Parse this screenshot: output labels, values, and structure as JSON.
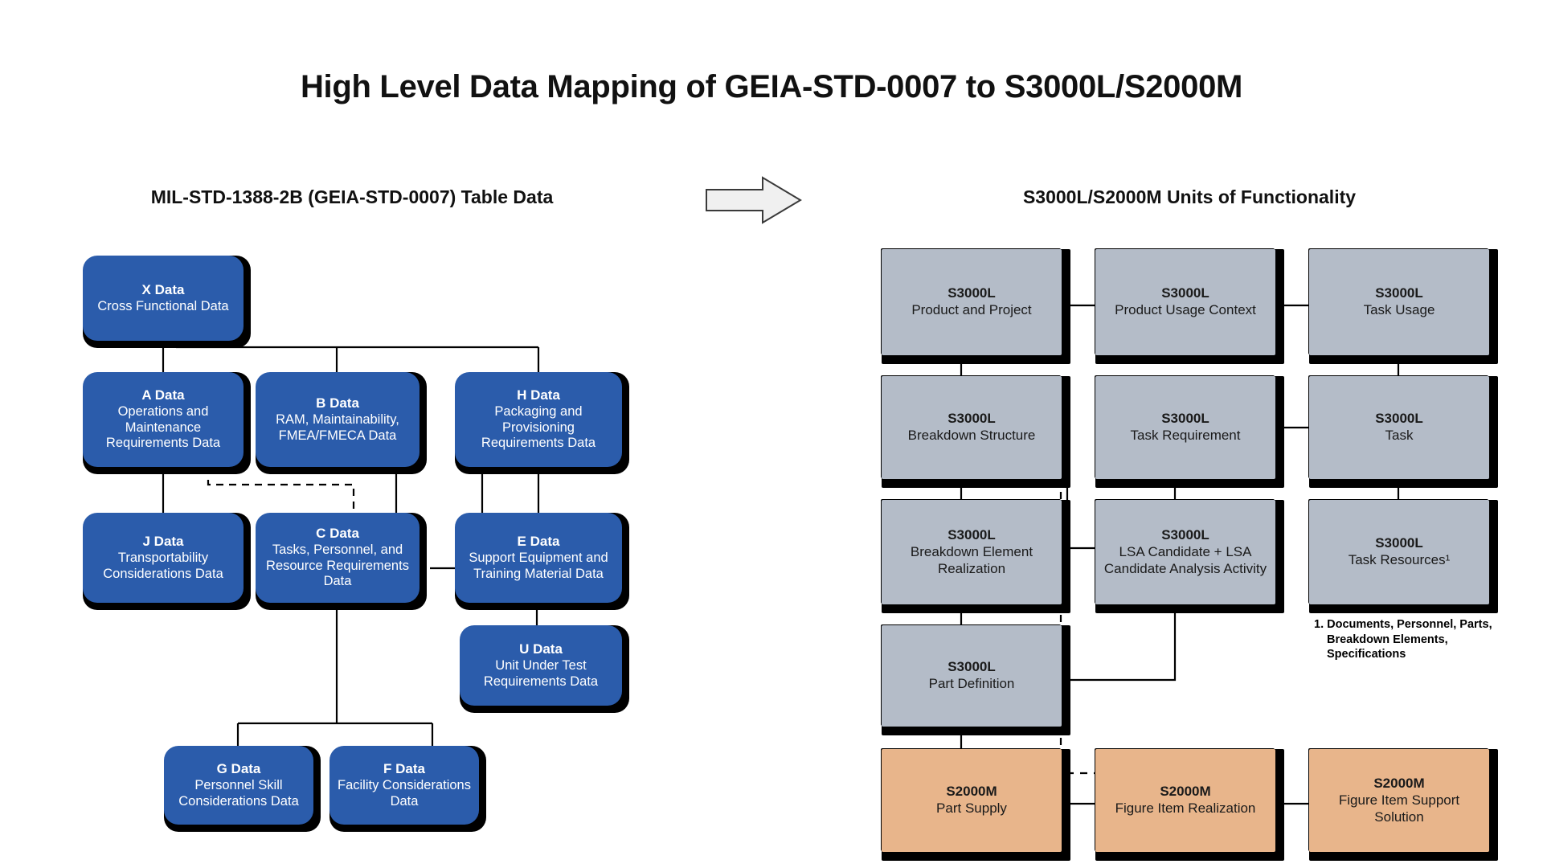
{
  "title": "High Level Data Mapping of GEIA-STD-0007 to S3000L/S2000M",
  "columns": {
    "left_heading": "MIL-STD-1388-2B (GEIA-STD-0007) Table Data",
    "right_heading": "S3000L/S2000M Units of Functionality"
  },
  "arrow": {
    "name": "maps-to-arrow",
    "direction": "right"
  },
  "colors": {
    "blue_box": "#2b5cab",
    "gray_box": "#b4bcc8",
    "tan_box": "#e8b58b",
    "shadow": "#000000",
    "text_on_blue": "#ffffff",
    "text_on_gray": "#1a1a1a",
    "title_text": "#111111"
  },
  "left_nodes": [
    {
      "id": "x",
      "title": "X Data",
      "desc": "Cross Functional Data"
    },
    {
      "id": "a",
      "title": "A Data",
      "desc": "Operations and Maintenance Requirements Data"
    },
    {
      "id": "b",
      "title": "B Data",
      "desc": "RAM, Maintainability, FMEA/FMECA Data"
    },
    {
      "id": "h",
      "title": "H Data",
      "desc": "Packaging and Provisioning Requirements Data"
    },
    {
      "id": "j",
      "title": "J Data",
      "desc": "Transportability Considerations Data"
    },
    {
      "id": "c",
      "title": "C Data",
      "desc": "Tasks, Personnel, and Resource Requirements Data"
    },
    {
      "id": "e",
      "title": "E Data",
      "desc": "Support Equipment and Training Material Data"
    },
    {
      "id": "u",
      "title": "U Data",
      "desc": "Unit Under Test Requirements Data"
    },
    {
      "id": "g",
      "title": "G Data",
      "desc": "Personnel Skill Considerations Data"
    },
    {
      "id": "f",
      "title": "F Data",
      "desc": "Facility Considerations Data"
    }
  ],
  "right_nodes": [
    {
      "id": "r1",
      "title": "S3000L",
      "desc": "Product and Project",
      "kind": "gray"
    },
    {
      "id": "r2",
      "title": "S3000L",
      "desc": "Product Usage Context",
      "kind": "gray"
    },
    {
      "id": "r3",
      "title": "S3000L",
      "desc": "Task Usage",
      "kind": "gray"
    },
    {
      "id": "r4",
      "title": "S3000L",
      "desc": "Breakdown Structure",
      "kind": "gray"
    },
    {
      "id": "r5",
      "title": "S3000L",
      "desc": "Task Requirement",
      "kind": "gray"
    },
    {
      "id": "r6",
      "title": "S3000L",
      "desc": "Task",
      "kind": "gray"
    },
    {
      "id": "r7",
      "title": "S3000L",
      "desc": "Breakdown Element Realization",
      "kind": "gray"
    },
    {
      "id": "r8",
      "title": "S3000L",
      "desc": "LSA Candidate + LSA Candidate Analysis Activity",
      "kind": "gray"
    },
    {
      "id": "r9",
      "title": "S3000L",
      "desc": "Task Resources¹",
      "kind": "gray"
    },
    {
      "id": "r10",
      "title": "S3000L",
      "desc": "Part Definition",
      "kind": "gray"
    },
    {
      "id": "r11",
      "title": "S2000M",
      "desc": "Part Supply",
      "kind": "tan"
    },
    {
      "id": "r12",
      "title": "S2000M",
      "desc": "Figure Item Realization",
      "kind": "tan"
    },
    {
      "id": "r13",
      "title": "S2000M",
      "desc": "Figure Item Support Solution",
      "kind": "tan"
    }
  ],
  "footnote": "1. Documents, Personnel, Parts, Breakdown Elements, Specifications"
}
